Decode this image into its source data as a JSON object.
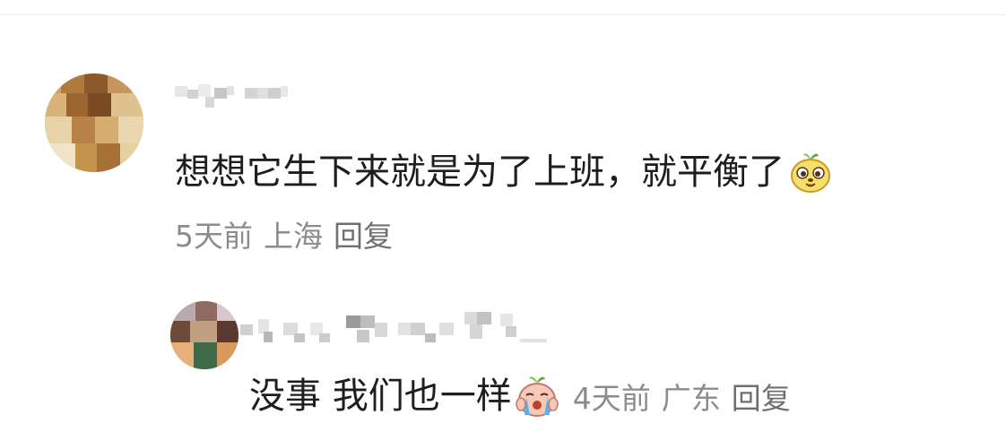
{
  "comment": {
    "text": "想想它生下来就是为了上班，就平衡了",
    "emoji_icon": "sprout-potato-face-icon",
    "time": "5天前",
    "location": "上海",
    "reply_label": "回复"
  },
  "reply": {
    "text": "没事 我们也一样",
    "emoji_icon": "crying-sprout-face-icon",
    "time": "4天前",
    "location": "广东",
    "reply_label": "回复"
  },
  "colors": {
    "text": "#1e1e1e",
    "meta": "#8c8c8c",
    "background": "#ffffff"
  }
}
